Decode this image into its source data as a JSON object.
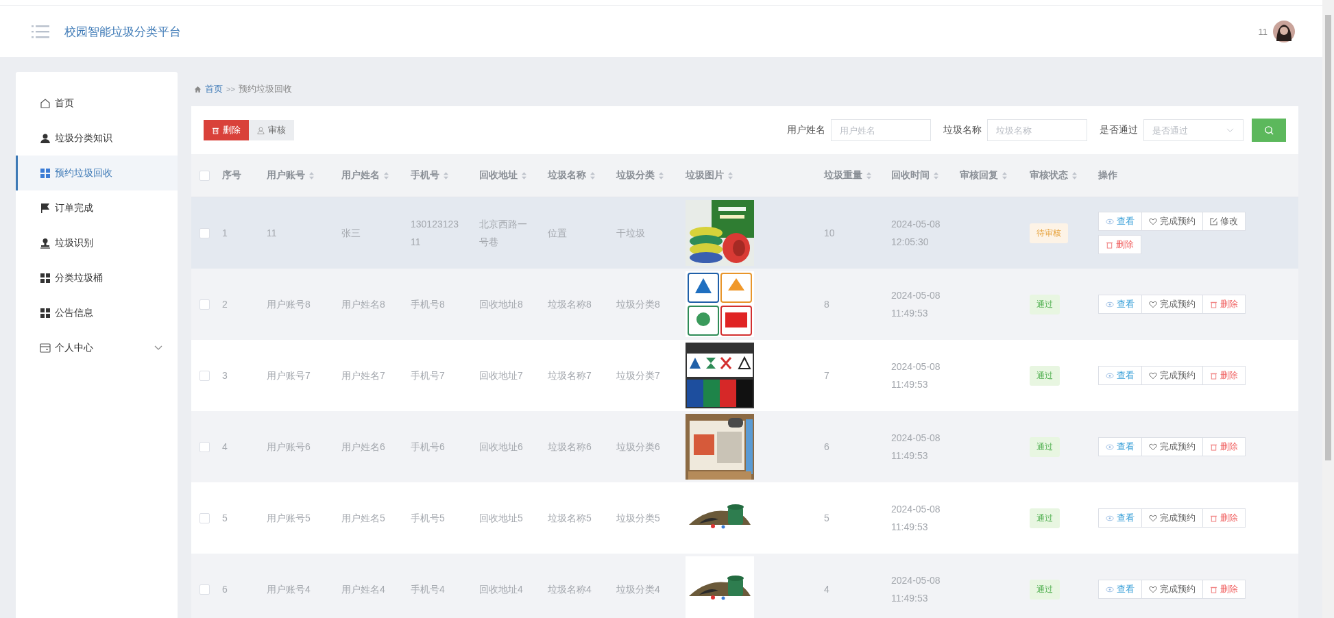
{
  "header": {
    "title": "校园智能垃圾分类平台",
    "username": "11"
  },
  "sidebar": {
    "items": [
      {
        "label": "首页",
        "selected": false,
        "expandable": false
      },
      {
        "label": "垃圾分类知识",
        "selected": false,
        "expandable": false
      },
      {
        "label": "预约垃圾回收",
        "selected": true,
        "expandable": false
      },
      {
        "label": "订单完成",
        "selected": false,
        "expandable": false
      },
      {
        "label": "垃圾识别",
        "selected": false,
        "expandable": false
      },
      {
        "label": "分类垃圾桶",
        "selected": false,
        "expandable": false
      },
      {
        "label": "公告信息",
        "selected": false,
        "expandable": false
      },
      {
        "label": "个人中心",
        "selected": false,
        "expandable": true
      }
    ]
  },
  "breadcrumb": {
    "home": "首页",
    "separator": ">>",
    "current": "预约垃圾回收"
  },
  "toolbar": {
    "buttons": [
      {
        "label": "删除",
        "kind": "danger"
      },
      {
        "label": "审核",
        "kind": "default"
      }
    ],
    "filters": [
      {
        "label": "用户姓名",
        "placeholder": "用户姓名",
        "kind": "text"
      },
      {
        "label": "垃圾名称",
        "placeholder": "垃圾名称",
        "kind": "text"
      },
      {
        "label": "是否通过",
        "placeholder": "是否通过",
        "kind": "select"
      }
    ]
  },
  "table": {
    "select_all": {
      "checked": false
    },
    "columns": [
      {
        "label": "序号",
        "sortable": false
      },
      {
        "label": "用户账号",
        "sortable": true
      },
      {
        "label": "用户姓名",
        "sortable": true
      },
      {
        "label": "手机号",
        "sortable": true
      },
      {
        "label": "回收地址",
        "sortable": true
      },
      {
        "label": "垃圾名称",
        "sortable": true
      },
      {
        "label": "垃圾分类",
        "sortable": true
      },
      {
        "label": "垃圾图片",
        "sortable": true
      },
      {
        "label": "垃圾重量",
        "sortable": true
      },
      {
        "label": "回收时间",
        "sortable": true
      },
      {
        "label": "审核回复",
        "sortable": true
      },
      {
        "label": "审核状态",
        "sortable": true
      },
      {
        "label": "操作",
        "sortable": false
      }
    ],
    "rows": [
      {
        "checked": false,
        "hover": true,
        "cells": [
          "1",
          "11",
          "张三",
          "13012312311",
          "北京西路一号巷",
          "位置",
          "干垃圾"
        ],
        "weight": "10",
        "time": "2024-05-08 12:05:30",
        "status": {
          "text": "待审核",
          "kind": "pending"
        },
        "actions": [
          {
            "label": "查看",
            "kind": "view"
          },
          {
            "label": "完成预约",
            "kind": "complete"
          },
          {
            "label": "修改",
            "kind": "edit"
          },
          {
            "label": "删除",
            "kind": "delete"
          }
        ]
      },
      {
        "checked": false,
        "hover": false,
        "cells": [
          "2",
          "用户账号8",
          "用户姓名8",
          "手机号8",
          "回收地址8",
          "垃圾名称8",
          "垃圾分类8"
        ],
        "weight": "8",
        "time": "2024-05-08 11:49:53",
        "status": {
          "text": "通过",
          "kind": "pass"
        },
        "actions": [
          {
            "label": "查看",
            "kind": "view"
          },
          {
            "label": "完成预约",
            "kind": "complete"
          },
          {
            "label": "删除",
            "kind": "delete"
          }
        ]
      },
      {
        "checked": false,
        "hover": false,
        "cells": [
          "3",
          "用户账号7",
          "用户姓名7",
          "手机号7",
          "回收地址7",
          "垃圾名称7",
          "垃圾分类7"
        ],
        "weight": "7",
        "time": "2024-05-08 11:49:53",
        "status": {
          "text": "通过",
          "kind": "pass"
        },
        "actions": [
          {
            "label": "查看",
            "kind": "view"
          },
          {
            "label": "完成预约",
            "kind": "complete"
          },
          {
            "label": "删除",
            "kind": "delete"
          }
        ]
      },
      {
        "checked": false,
        "hover": false,
        "cells": [
          "4",
          "用户账号6",
          "用户姓名6",
          "手机号6",
          "回收地址6",
          "垃圾名称6",
          "垃圾分类6"
        ],
        "weight": "6",
        "time": "2024-05-08 11:49:53",
        "status": {
          "text": "通过",
          "kind": "pass"
        },
        "actions": [
          {
            "label": "查看",
            "kind": "view"
          },
          {
            "label": "完成预约",
            "kind": "complete"
          },
          {
            "label": "删除",
            "kind": "delete"
          }
        ]
      },
      {
        "checked": false,
        "hover": false,
        "cells": [
          "5",
          "用户账号5",
          "用户姓名5",
          "手机号5",
          "回收地址5",
          "垃圾名称5",
          "垃圾分类5"
        ],
        "weight": "5",
        "time": "2024-05-08 11:49:53",
        "status": {
          "text": "通过",
          "kind": "pass"
        },
        "actions": [
          {
            "label": "查看",
            "kind": "view"
          },
          {
            "label": "完成预约",
            "kind": "complete"
          },
          {
            "label": "删除",
            "kind": "delete"
          }
        ]
      },
      {
        "checked": false,
        "hover": false,
        "cells": [
          "6",
          "用户账号4",
          "用户姓名4",
          "手机号4",
          "回收地址4",
          "垃圾名称4",
          "垃圾分类4"
        ],
        "weight": "4",
        "time": "2024-05-08 11:49:53",
        "status": {
          "text": "通过",
          "kind": "pass"
        },
        "actions": [
          {
            "label": "查看",
            "kind": "view"
          },
          {
            "label": "完成预约",
            "kind": "complete"
          },
          {
            "label": "删除",
            "kind": "delete"
          }
        ]
      }
    ]
  }
}
